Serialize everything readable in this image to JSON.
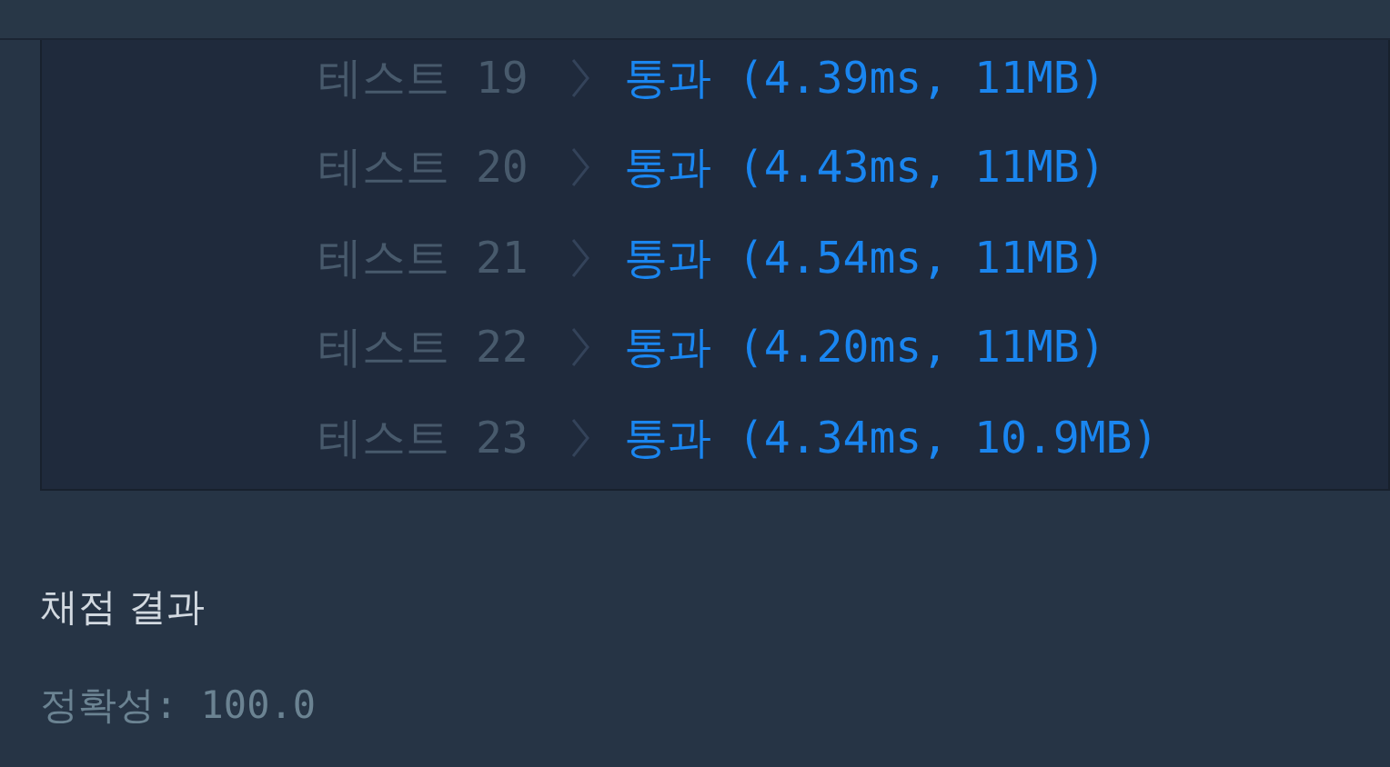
{
  "tests": [
    {
      "label": "테스트 19",
      "result": "통과 (4.39ms, 11MB)"
    },
    {
      "label": "테스트 20",
      "result": "통과 (4.43ms, 11MB)"
    },
    {
      "label": "테스트 21",
      "result": "통과 (4.54ms, 11MB)"
    },
    {
      "label": "테스트 22",
      "result": "통과 (4.20ms, 11MB)"
    },
    {
      "label": "테스트 23",
      "result": "통과 (4.34ms, 10.9MB)"
    }
  ],
  "summary": {
    "title": "채점 결과",
    "accuracy": "정확성: 100.0"
  }
}
